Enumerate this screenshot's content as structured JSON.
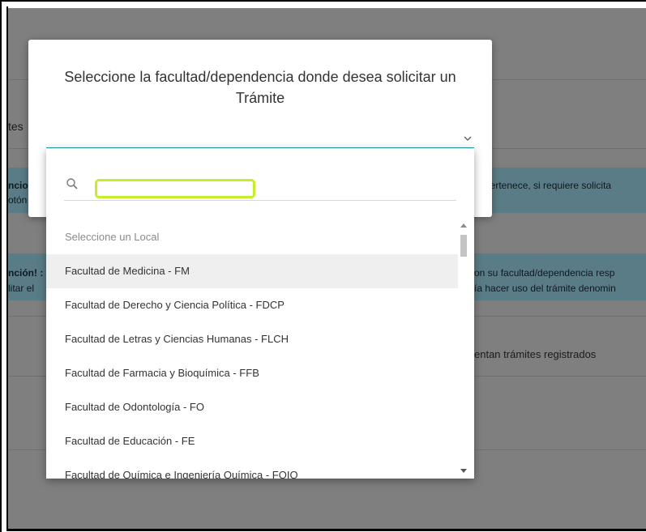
{
  "background": {
    "tab_fragment": "tes",
    "alert1_left_line1": "ncio",
    "alert1_left_line2": "otón",
    "alert1_right": "pertenece, si requiere solicita",
    "alert2_left_line1": "nción! :",
    "alert2_left_line2": "litar el",
    "alert2_right_line1": "on su facultad/dependencia resp",
    "alert2_right_line2": "ía hacer uso del trámite denomin",
    "info_right": "entan trámites registrados"
  },
  "modal": {
    "title": "Seleccione la facultad/dependencia donde desea solicitar un Trámite"
  },
  "search": {
    "value": "",
    "placeholder": ""
  },
  "dropdown": {
    "placeholder_option": "Seleccione un Local",
    "options": [
      "Facultad de Medicina - FM",
      "Facultad de Derecho y Ciencia Política - FDCP",
      "Facultad de Letras y Ciencias Humanas - FLCH",
      "Facultad de Farmacia y Bioquímica - FFB",
      "Facultad de Odontología - FO",
      "Facultad de Educación - FE",
      "Facultad de Química e Ingeniería Química - FQIQ"
    ]
  },
  "colors": {
    "accent": "#1aa59d",
    "highlight": "#c6ed2a",
    "overlay": "#7f7f7f"
  },
  "icons": [
    "search-icon",
    "chevron-down-icon",
    "scroll-up-icon",
    "scroll-down-icon"
  ]
}
